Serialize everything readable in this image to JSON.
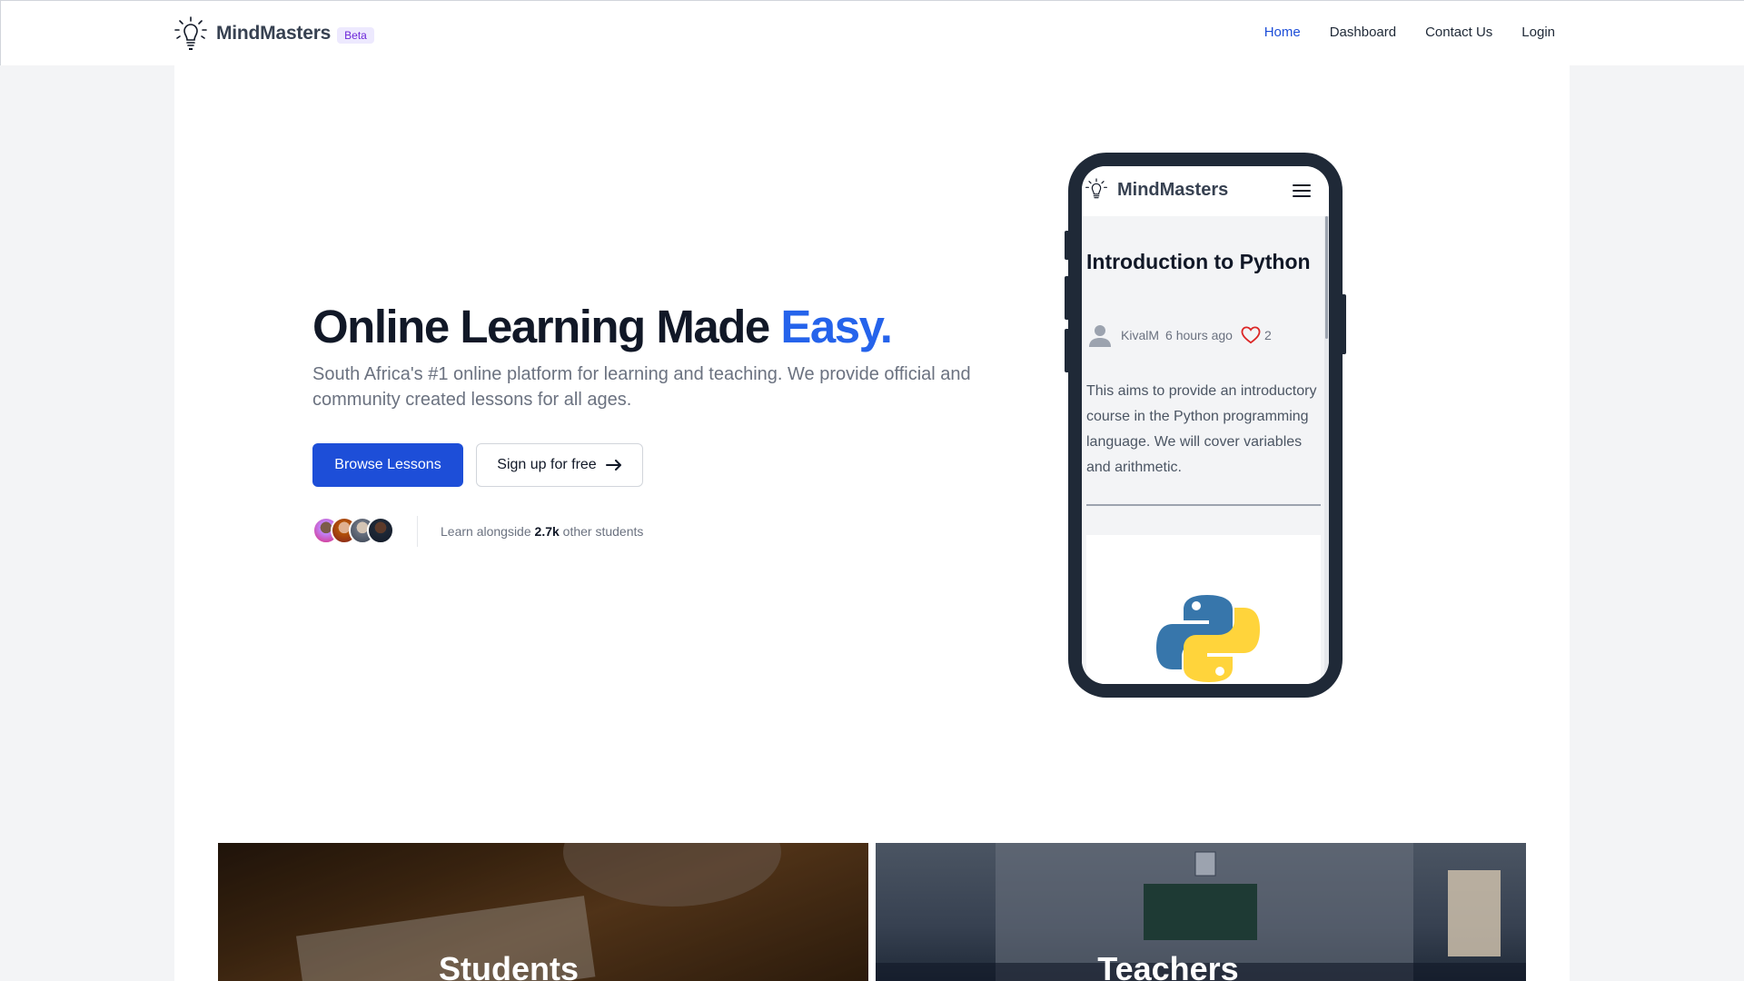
{
  "nav": {
    "brand": "MindMasters",
    "badge": "Beta",
    "links": [
      {
        "label": "Home",
        "active": true
      },
      {
        "label": "Dashboard",
        "active": false
      },
      {
        "label": "Contact Us",
        "active": false
      },
      {
        "label": "Login",
        "active": false
      }
    ]
  },
  "hero": {
    "title_main": "Online Learning Made ",
    "title_accent": "Easy.",
    "subtitle": "South Africa's #1 online platform for learning and teaching. We provide official and community created lessons for all ages.",
    "primary_button": "Browse Lessons",
    "secondary_button": "Sign up for free",
    "students_prefix": "Learn alongside ",
    "students_count": "2.7k",
    "students_suffix": " other students"
  },
  "phone": {
    "brand": "MindMasters",
    "lesson_title": "Introduction to Python",
    "author": "KivalM",
    "time": "6 hours ago",
    "likes": "2",
    "description": "This aims to provide an introductory course in the Python programming language. We will cover variables and arithmetic."
  },
  "categories": [
    {
      "label": "Students"
    },
    {
      "label": "Teachers"
    }
  ],
  "colors": {
    "accent": "#2563eb",
    "primary_button": "#1d4ed8",
    "beta_bg": "#ede9fe",
    "beta_text": "#6d28d9",
    "heart": "#dc2626"
  },
  "icons": [
    "lightbulb-logo-icon",
    "hamburger-menu-icon",
    "user-icon",
    "heart-icon",
    "arrow-right-icon",
    "python-logo-icon"
  ]
}
